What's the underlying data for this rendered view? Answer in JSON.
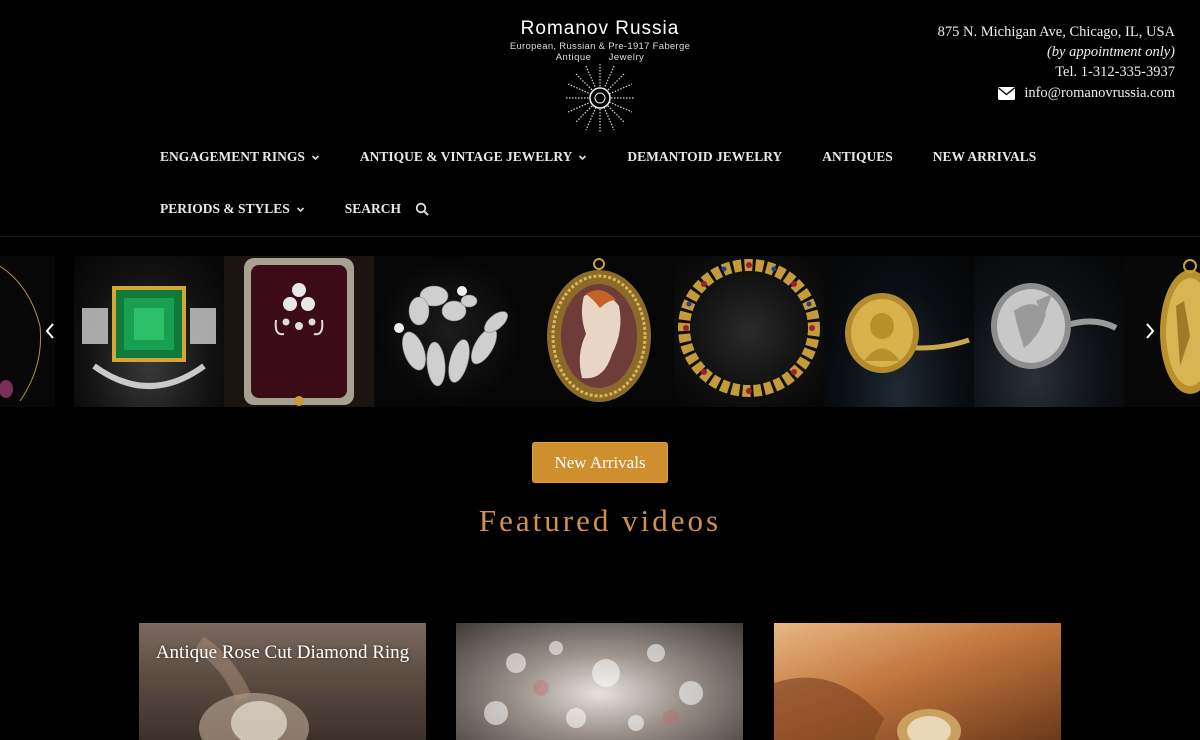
{
  "brand": {
    "title": "Romanov Russia",
    "subtitle": "European, Russian & Pre-1917 Faberge",
    "subtitle2": "Antique Jewelry"
  },
  "contact": {
    "address": "875 N. Michigan Ave, Chicago, IL, USA",
    "appointment": "(by appointment only)",
    "phone": "Tel. 1-312-335-3937",
    "email": "info@romanovrussia.com"
  },
  "nav": {
    "row1": [
      {
        "label": "ENGAGEMENT RINGS",
        "dropdown": true
      },
      {
        "label": "ANTIQUE & VINTAGE JEWELRY",
        "dropdown": true
      },
      {
        "label": "DEMANTOID JEWELRY",
        "dropdown": false
      },
      {
        "label": "ANTIQUES",
        "dropdown": false
      },
      {
        "label": "NEW ARRIVALS",
        "dropdown": false
      }
    ],
    "row2": [
      {
        "label": "PERIODS & STYLES",
        "dropdown": true
      },
      {
        "label": "SEARCH",
        "dropdown": false
      }
    ]
  },
  "carousel": {
    "prev_icon": "chevron-left-icon",
    "next_icon": "chevron-right-icon",
    "items": [
      "necklace",
      "emerald-ring",
      "diamond-brooch-in-box",
      "diamond-floral-brooch",
      "cameo-pendant",
      "gold-gem-bracelet",
      "gold-signet-ring",
      "silver-intaglio-ring",
      "gold-pendant"
    ]
  },
  "cta": {
    "label": "New Arrivals"
  },
  "featured": {
    "heading": "Featured videos"
  },
  "videos": [
    {
      "title": "Antique Rose Cut Diamond Ring"
    },
    {
      "title": ""
    },
    {
      "title": ""
    }
  ],
  "colors": {
    "accent": "#d08f2e",
    "heading": "#d1914a",
    "background": "#000000"
  }
}
